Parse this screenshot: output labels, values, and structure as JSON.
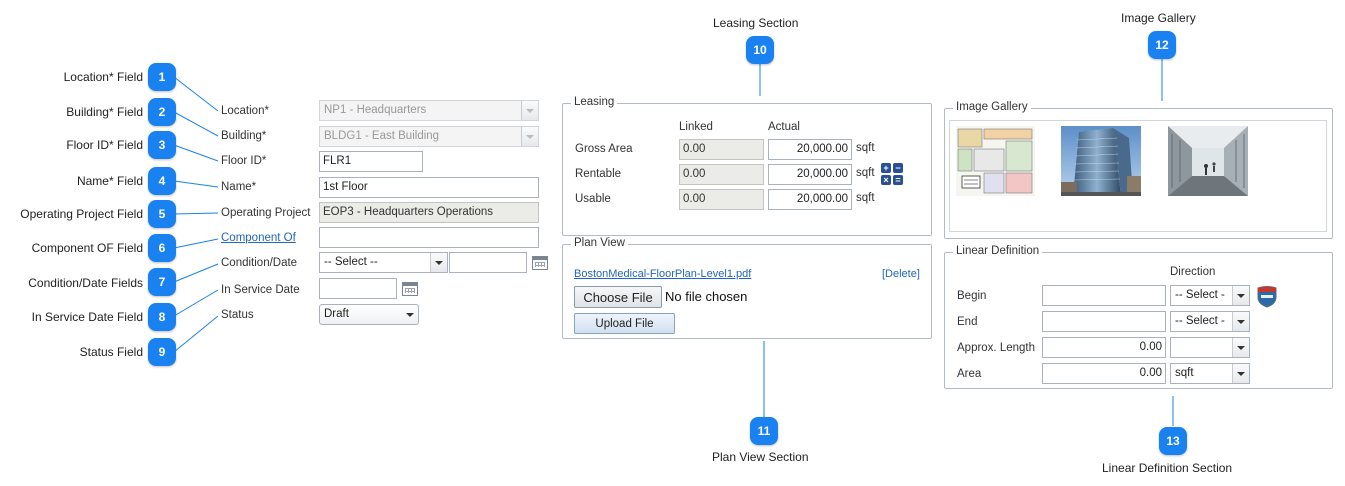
{
  "callouts": {
    "c1": {
      "num": "1",
      "label": "Location* Field"
    },
    "c2": {
      "num": "2",
      "label": "Building* Field"
    },
    "c3": {
      "num": "3",
      "label": "Floor ID* Field"
    },
    "c4": {
      "num": "4",
      "label": "Name* Field"
    },
    "c5": {
      "num": "5",
      "label": "Operating Project Field"
    },
    "c6": {
      "num": "6",
      "label": "Component OF Field"
    },
    "c7": {
      "num": "7",
      "label": "Condition/Date Fields"
    },
    "c8": {
      "num": "8",
      "label": "In Service Date Field"
    },
    "c9": {
      "num": "9",
      "label": "Status Field"
    },
    "c10": {
      "num": "10",
      "label": "Leasing Section"
    },
    "c11": {
      "num": "11",
      "label": "Plan View Section"
    },
    "c12": {
      "num": "12",
      "label": "Image Gallery"
    },
    "c13": {
      "num": "13",
      "label": "Linear Definition Section"
    }
  },
  "form": {
    "location_label": "Location*",
    "location_value": "NP1 - Headquarters",
    "building_label": "Building*",
    "building_value": "BLDG1 - East Building",
    "floor_id_label": "Floor ID*",
    "floor_id_value": "FLR1",
    "name_label": "Name*",
    "name_value": "1st Floor",
    "operating_project_label": "Operating Project",
    "operating_project_value": "EOP3 - Headquarters Operations",
    "component_of_label": "Component Of",
    "component_of_value": "",
    "condition_date_label": "Condition/Date",
    "condition_value": "-- Select --",
    "condition_date_value": "",
    "in_service_date_label": "In Service Date",
    "in_service_date_value": "",
    "status_label": "Status",
    "status_value": "Draft"
  },
  "leasing": {
    "legend": "Leasing",
    "col_linked": "Linked",
    "col_actual": "Actual",
    "rows": [
      {
        "label": "Gross Area",
        "linked": "0.00",
        "actual": "20,000.00",
        "unit": "sqft"
      },
      {
        "label": "Rentable",
        "linked": "0.00",
        "actual": "20,000.00",
        "unit": "sqft"
      },
      {
        "label": "Usable",
        "linked": "0.00",
        "actual": "20,000.00",
        "unit": "sqft"
      }
    ]
  },
  "plan_view": {
    "legend": "Plan View",
    "file_link": "BostonMedical-FloorPlan-Level1.pdf",
    "delete_label": "[Delete]",
    "choose_file_label": "Choose File",
    "no_file_text": "No file chosen",
    "upload_label": "Upload File"
  },
  "gallery": {
    "legend": "Image Gallery",
    "images": [
      "floor-plan-thumbnail",
      "building-exterior-thumbnail",
      "interior-walkway-thumbnail"
    ]
  },
  "linear": {
    "legend": "Linear Definition",
    "col_direction": "Direction",
    "rows": [
      {
        "label": "Begin",
        "value": "",
        "select": "-- Select -"
      },
      {
        "label": "End",
        "value": "",
        "select": "-- Select -"
      },
      {
        "label": "Approx. Length",
        "value": "0.00",
        "select": ""
      },
      {
        "label": "Area",
        "value": "0.00",
        "select": "sqft"
      }
    ]
  },
  "colors": {
    "badge": "#1a82f0",
    "link": "#2266bb",
    "line": "#1a82f0"
  }
}
